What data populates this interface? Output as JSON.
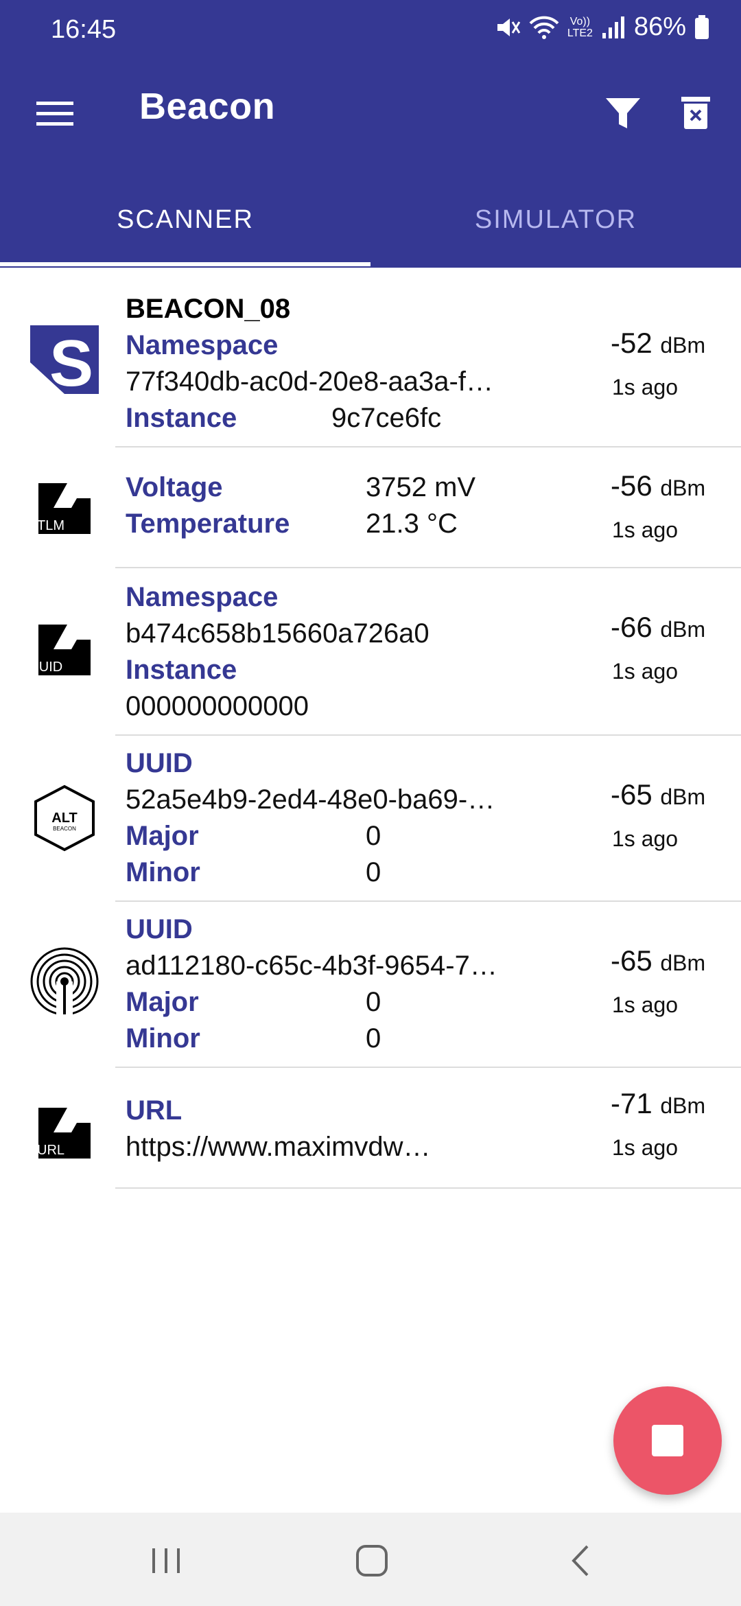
{
  "status_bar": {
    "time": "16:45",
    "battery_percent": "86%",
    "network_label_top": "Vo))",
    "network_label_bottom": "LTE2"
  },
  "app_bar": {
    "title": "Beacon",
    "menu_icon": "menu-icon",
    "filter_icon": "filter-icon",
    "clear_icon": "clear-list-icon"
  },
  "tabs": [
    {
      "label": "SCANNER",
      "active": true
    },
    {
      "label": "SIMULATOR",
      "active": false
    }
  ],
  "beacons": [
    {
      "type": "eddystone-uid-s",
      "name": "BEACON_08",
      "namespace_label": "Namespace",
      "namespace": "77f340db-ac0d-20e8-aa3a-f…",
      "instance_label": "Instance",
      "instance": "9c7ce6fc",
      "rssi": "-52",
      "unit": "dBm",
      "ago": "1s ago"
    },
    {
      "type": "eddystone-tlm",
      "icon_text": "TLM",
      "voltage_label": "Voltage",
      "voltage": "3752 mV",
      "temperature_label": "Temperature",
      "temperature": "21.3 °C",
      "rssi": "-56",
      "unit": "dBm",
      "ago": "1s ago"
    },
    {
      "type": "eddystone-uid",
      "icon_text": "UID",
      "namespace_label": "Namespace",
      "namespace": "b474c658b15660a726a0",
      "instance_label": "Instance",
      "instance": "000000000000",
      "rssi": "-66",
      "unit": "dBm",
      "ago": "1s ago"
    },
    {
      "type": "altbeacon",
      "icon_text_top": "ALT",
      "icon_text_bottom": "BEACON",
      "uuid_label": "UUID",
      "uuid": "52a5e4b9-2ed4-48e0-ba69-…",
      "major_label": "Major",
      "major": "0",
      "minor_label": "Minor",
      "minor": "0",
      "rssi": "-65",
      "unit": "dBm",
      "ago": "1s ago"
    },
    {
      "type": "ibeacon",
      "uuid_label": "UUID",
      "uuid": "ad112180-c65c-4b3f-9654-7…",
      "major_label": "Major",
      "major": "0",
      "minor_label": "Minor",
      "minor": "0",
      "rssi": "-65",
      "unit": "dBm",
      "ago": "1s ago"
    },
    {
      "type": "eddystone-url",
      "icon_text": "URL",
      "url_label": "URL",
      "url": "https://www.maximvdw…",
      "rssi": "-71",
      "unit": "dBm",
      "ago": "1s ago"
    }
  ],
  "fab": {
    "icon": "stop-icon"
  },
  "nav_bar": {
    "recents_icon": "recents-icon",
    "home_icon": "home-icon",
    "back_icon": "back-icon"
  },
  "colors": {
    "primary": "#353893",
    "accent_fab": "#ec5568",
    "tab_inactive": "#b7b8ef"
  }
}
